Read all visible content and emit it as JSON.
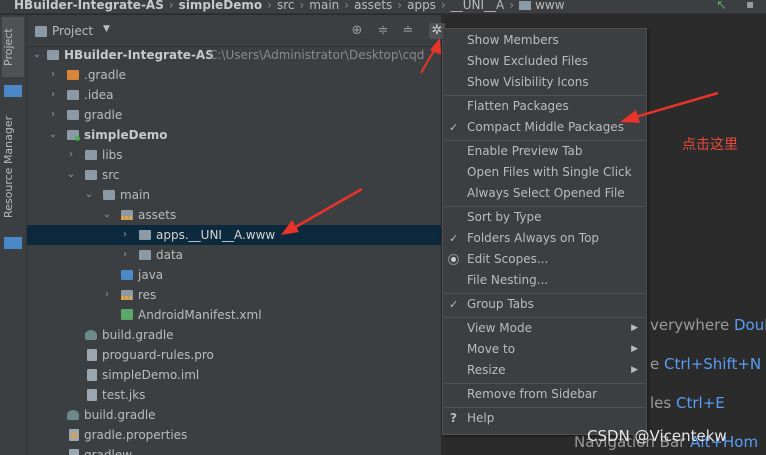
{
  "breadcrumb": {
    "items": [
      "HBuilder-Integrate-AS",
      "simpleDemo",
      "src",
      "main",
      "assets",
      "apps",
      "__UNI__A",
      "www"
    ],
    "separator": "›"
  },
  "side_tabs": {
    "project": "Project",
    "resource_manager": "Resource Manager"
  },
  "panel": {
    "title": "Project",
    "header_icons": [
      "target-icon",
      "expand-all-icon",
      "collapse-all-icon",
      "gear-icon"
    ]
  },
  "tree": [
    {
      "label": "HBuilder-Integrate-AS",
      "path": "C:\\Users\\Administrator\\Desktop\\cqd",
      "expanded": true,
      "icon": "project-folder-icon"
    },
    {
      "label": ".gradle",
      "icon": "folder-orange-icon"
    },
    {
      "label": ".idea",
      "icon": "folder-icon"
    },
    {
      "label": "gradle",
      "icon": "folder-icon"
    },
    {
      "label": "simpleDemo",
      "icon": "module-icon",
      "expanded": true
    },
    {
      "label": "libs",
      "icon": "folder-icon"
    },
    {
      "label": "src",
      "icon": "folder-icon",
      "expanded": true
    },
    {
      "label": "main",
      "icon": "folder-icon",
      "expanded": true
    },
    {
      "label": "assets",
      "icon": "resources-folder-icon",
      "expanded": true
    },
    {
      "label": "apps.__UNI__A.www",
      "icon": "folder-icon",
      "selected": true
    },
    {
      "label": "data",
      "icon": "folder-icon"
    },
    {
      "label": "java",
      "icon": "java-folder-icon"
    },
    {
      "label": "res",
      "icon": "resources-folder-icon"
    },
    {
      "label": "AndroidManifest.xml",
      "icon": "manifest-icon"
    },
    {
      "label": "build.gradle",
      "icon": "gradle-icon"
    },
    {
      "label": "proguard-rules.pro",
      "icon": "file-icon"
    },
    {
      "label": "simpleDemo.iml",
      "icon": "file-icon"
    },
    {
      "label": "test.jks",
      "icon": "file-icon"
    },
    {
      "label": "build.gradle",
      "icon": "gradle-icon"
    },
    {
      "label": "gradle.properties",
      "icon": "properties-icon"
    },
    {
      "label": "gradlew",
      "icon": "file-icon"
    }
  ],
  "menu": {
    "groups": [
      [
        {
          "label": "Show Members",
          "checked": false
        },
        {
          "label": "Show Excluded Files",
          "checked": false
        },
        {
          "label": "Show Visibility Icons",
          "checked": false
        }
      ],
      [
        {
          "label": "Flatten Packages",
          "checked": false
        },
        {
          "label": "Compact Middle Packages",
          "checked": true
        }
      ],
      [
        {
          "label": "Enable Preview Tab",
          "checked": false
        },
        {
          "label": "Open Files with Single Click",
          "checked": false
        },
        {
          "label": "Always Select Opened File",
          "checked": false
        }
      ],
      [
        {
          "label": "Sort by Type",
          "checked": false
        },
        {
          "label": "Folders Always on Top",
          "checked": true
        },
        {
          "label": "Edit Scopes...",
          "radio": true
        },
        {
          "label": "File Nesting...",
          "checked": false
        }
      ],
      [
        {
          "label": "Group Tabs",
          "checked": true
        }
      ],
      [
        {
          "label": "View Mode",
          "submenu": true
        },
        {
          "label": "Move to",
          "submenu": true
        },
        {
          "label": "Resize",
          "submenu": true
        }
      ],
      [
        {
          "label": "Remove from Sidebar"
        }
      ],
      [
        {
          "label": "Help",
          "help": true
        }
      ]
    ]
  },
  "editor_hints": [
    {
      "text": "verywhere",
      "shortcut": "Doub"
    },
    {
      "text": "e",
      "shortcut": "Ctrl+Shift+N"
    },
    {
      "text": "les",
      "shortcut": "Ctrl+E"
    },
    {
      "text": "Navigation Bar",
      "shortcut": "Alt+Hom"
    }
  ],
  "annotation": "点击这里",
  "watermark": "CSDN @Vicentekw",
  "colors": {
    "selection": "#0d293e",
    "annotation_red": "#e84a3b",
    "shortcut_blue": "#589df6"
  }
}
